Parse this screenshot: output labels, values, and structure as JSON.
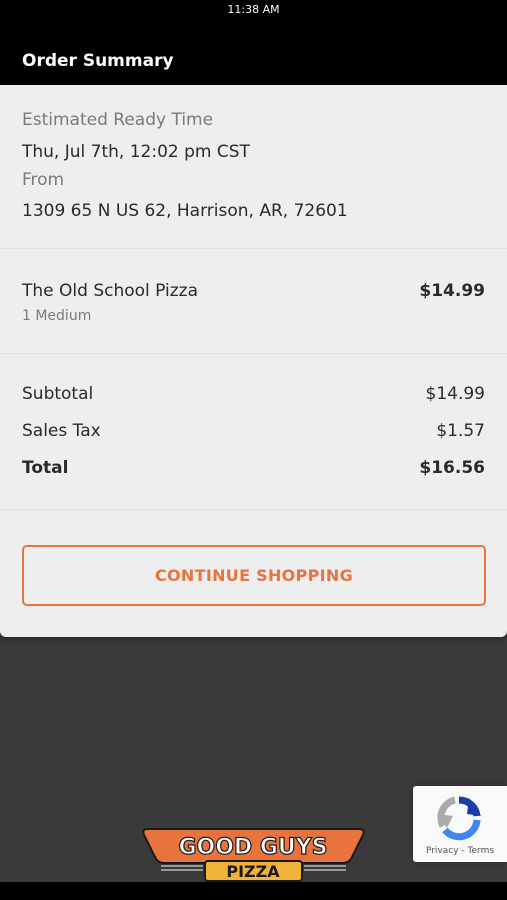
{
  "status_bar": {
    "time": "11:38 AM"
  },
  "header": {
    "title": "Order Summary"
  },
  "pickup": {
    "ready_label": "Estimated Ready Time",
    "ready_value": "Thu, Jul 7th, 12:02 pm CST",
    "from_label": "From",
    "address": "1309 65 N US 62, Harrison, AR, 72601"
  },
  "items": [
    {
      "name": "The Old School Pizza",
      "detail": "1 Medium",
      "price": "$14.99"
    }
  ],
  "totals": {
    "subtotal_label": "Subtotal",
    "subtotal_value": "$14.99",
    "tax_label": "Sales Tax",
    "tax_value": "$1.57",
    "total_label": "Total",
    "total_value": "$16.56"
  },
  "actions": {
    "continue_label": "CONTINUE SHOPPING"
  },
  "logo": {
    "line1": "GOOD GUYS",
    "line2": "PIZZA"
  },
  "recaptcha": {
    "privacy": "Privacy",
    "separator": " - ",
    "terms": "Terms"
  },
  "colors": {
    "accent": "#e8733c",
    "background": "#3a3a3a",
    "card": "#efeeee"
  }
}
